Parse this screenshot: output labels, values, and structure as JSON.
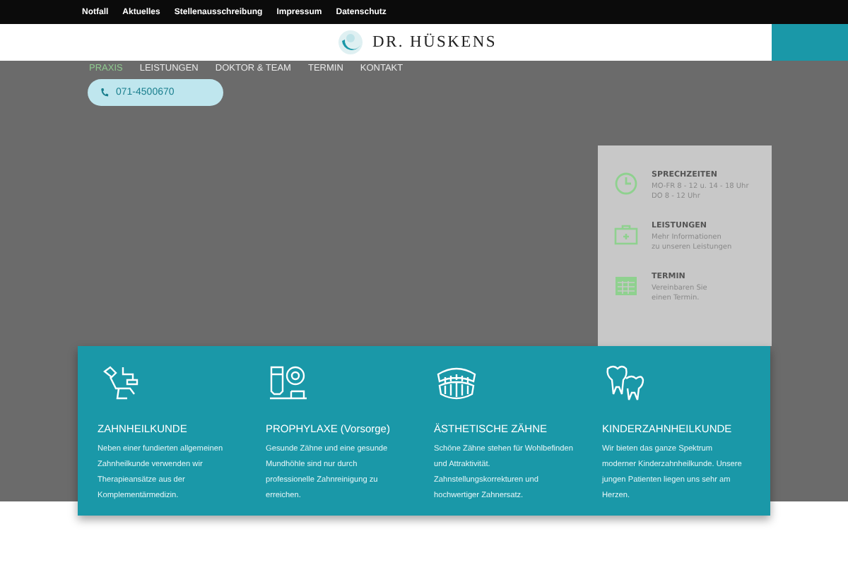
{
  "top_links": [
    "Notfall",
    "Aktuelles",
    "Stellenausschreibung",
    "Impressum",
    "Datenschutz"
  ],
  "logo": {
    "text": "DR. HÜSKENS"
  },
  "nav": [
    {
      "label": "PRAXIS",
      "selected": true
    },
    {
      "label": "LEISTUNGEN",
      "selected": false
    },
    {
      "label": "DOKTOR & TEAM",
      "selected": false
    },
    {
      "label": "TERMIN",
      "selected": false
    },
    {
      "label": "KONTAKT",
      "selected": false
    }
  ],
  "phone": "071-4500670",
  "info_panel": [
    {
      "kind": "clock",
      "title": "SPRECHZEITEN",
      "lines": [
        "MO-FR 8 - 12 u. 14 - 18 Uhr",
        "DO 8 - 12 Uhr"
      ]
    },
    {
      "kind": "case",
      "title": "LEISTUNGEN",
      "lines": [
        "Mehr Informationen",
        "zu unseren Leistungen"
      ]
    },
    {
      "kind": "calendar",
      "title": "TERMIN",
      "lines": [
        "Vereinbaren Sie",
        "einen Termin."
      ]
    }
  ],
  "services": [
    {
      "kind": "chair",
      "title": "ZAHNHEILKUNDE",
      "text": "Neben einer fundierten allgemeinen Zahnheilkunde verwenden wir Therapieansätze aus der Komplementärmedizin."
    },
    {
      "kind": "toothpaste",
      "title": "PROPHYLAXE (Vorsorge)",
      "text": "Gesunde Zähne und eine gesunde Mundhöhle sind nur durch professionelle Zahnreinigung zu erreichen."
    },
    {
      "kind": "denture",
      "title": "ÄSTHETISCHE ZÄHNE",
      "text": "Schöne Zähne stehen für Wohlbefinden und Attraktivität. Zahnstellungskorrekturen und hochwertiger Zahnersatz."
    },
    {
      "kind": "teeth",
      "title": "KINDERZAHNHEILKUNDE",
      "text": "Wir bieten das ganze Spektrum moderner Kinderzahnheilkunde. Unsere jungen Patienten liegen uns sehr am Herzen."
    }
  ]
}
